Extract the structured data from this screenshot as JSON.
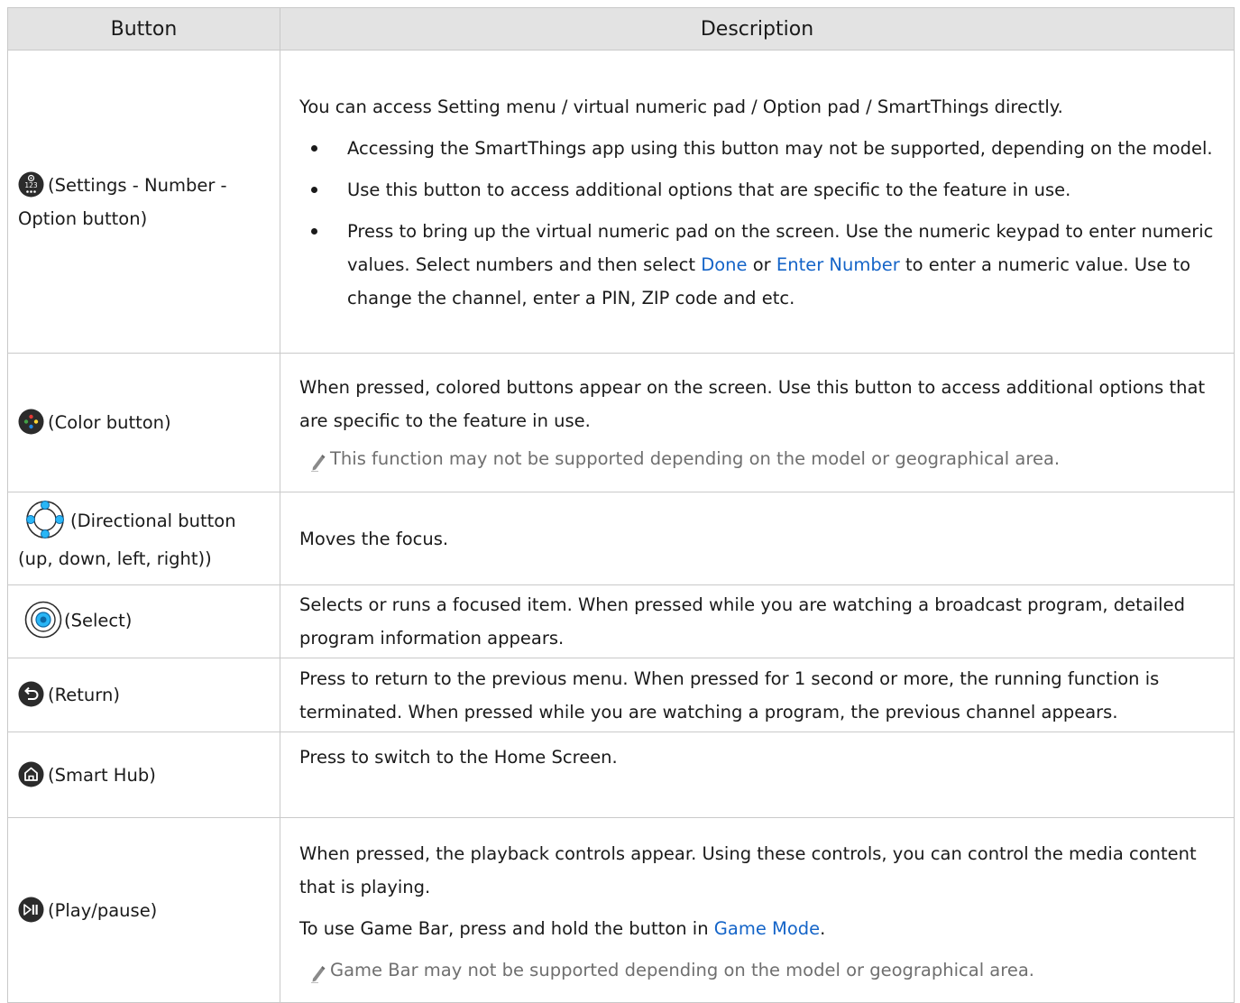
{
  "header": {
    "col_button": "Button",
    "col_description": "Description"
  },
  "rows": [
    {
      "icon": "settings-number-option-icon",
      "label_1": "(Settings - Number -",
      "label_2": "Option button)",
      "intro": "You can access Setting menu / virtual numeric pad / Option pad / SmartThings directly.",
      "bullets": [
        "Accessing the SmartThings app using this button may not be supported, depending on the model.",
        "Use this button to access additional options that are specific to the feature in use."
      ],
      "bullet3_a": "Press to bring up the virtual numeric pad on the screen. Use the numeric keypad to enter numeric values. Select numbers and then select ",
      "bullet3_link1": "Done",
      "bullet3_b": " or ",
      "bullet3_link2": "Enter Number",
      "bullet3_c": " to enter a numeric value. Use to change the channel, enter a PIN, ZIP code and etc."
    },
    {
      "icon": "color-button-icon",
      "label": "(Color button)",
      "desc": "When pressed, colored buttons appear on the screen. Use this button to access additional options that are specific to the feature in use.",
      "note": "This function may not be supported depending on the model or geographical area."
    },
    {
      "icon": "directional-button-icon",
      "label_1": "(Directional button",
      "label_2": "(up, down, left, right))",
      "desc": "Moves the focus."
    },
    {
      "icon": "select-button-icon",
      "label": "(Select)",
      "desc": "Selects or runs a focused item. When pressed while you are watching a broadcast program, detailed program information appears."
    },
    {
      "icon": "return-icon",
      "label": "(Return)",
      "desc": "Press to return to the previous menu. When pressed for 1 second or more, the running function is terminated. When pressed while you are watching a program, the previous channel appears."
    },
    {
      "icon": "home-icon",
      "label": "(Smart Hub)",
      "desc": "Press to switch to the Home Screen."
    },
    {
      "icon": "play-pause-icon",
      "label": "(Play/pause)",
      "desc": "When pressed, the playback controls appear. Using these controls, you can control the media content that is playing.",
      "game_a": "To use Game Bar, press and hold the button in ",
      "game_link": "Game Mode",
      "game_b": ".",
      "note": "Game Bar may not be supported depending on the model or geographical area."
    }
  ],
  "colors": {
    "link": "#1464c8",
    "header_bg": "#e3e3e3",
    "note_text": "#6f6f6f",
    "border": "#c9c9c9"
  }
}
